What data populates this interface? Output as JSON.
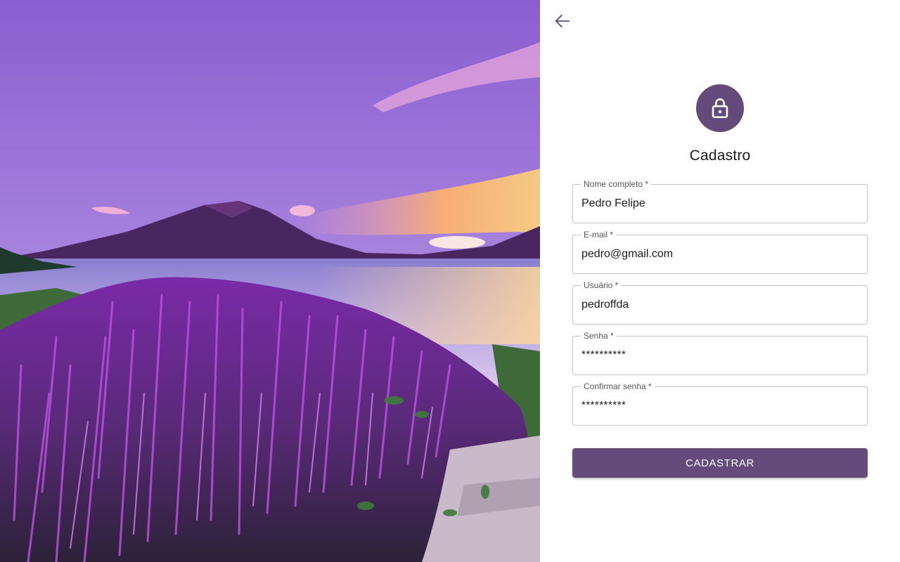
{
  "hero": {
    "alt_icon": "lake-volcano-flowers-photo"
  },
  "nav": {
    "back_icon": "arrow-left-icon"
  },
  "header": {
    "avatar_icon": "lock-icon",
    "title": "Cadastro"
  },
  "form": {
    "fields": [
      {
        "label": "Nome completo *",
        "value": "Pedro Felipe"
      },
      {
        "label": "E-mail *",
        "value": "pedro@gmail.com"
      },
      {
        "label": "Usuário *",
        "value": "pedroffda"
      },
      {
        "label": "Senha *",
        "value": "**********"
      },
      {
        "label": "Confirmar senha *",
        "value": "**********"
      }
    ],
    "submit_label": "CADASTRAR"
  },
  "colors": {
    "accent": "#654a7c",
    "border": "#c4c4c4"
  }
}
